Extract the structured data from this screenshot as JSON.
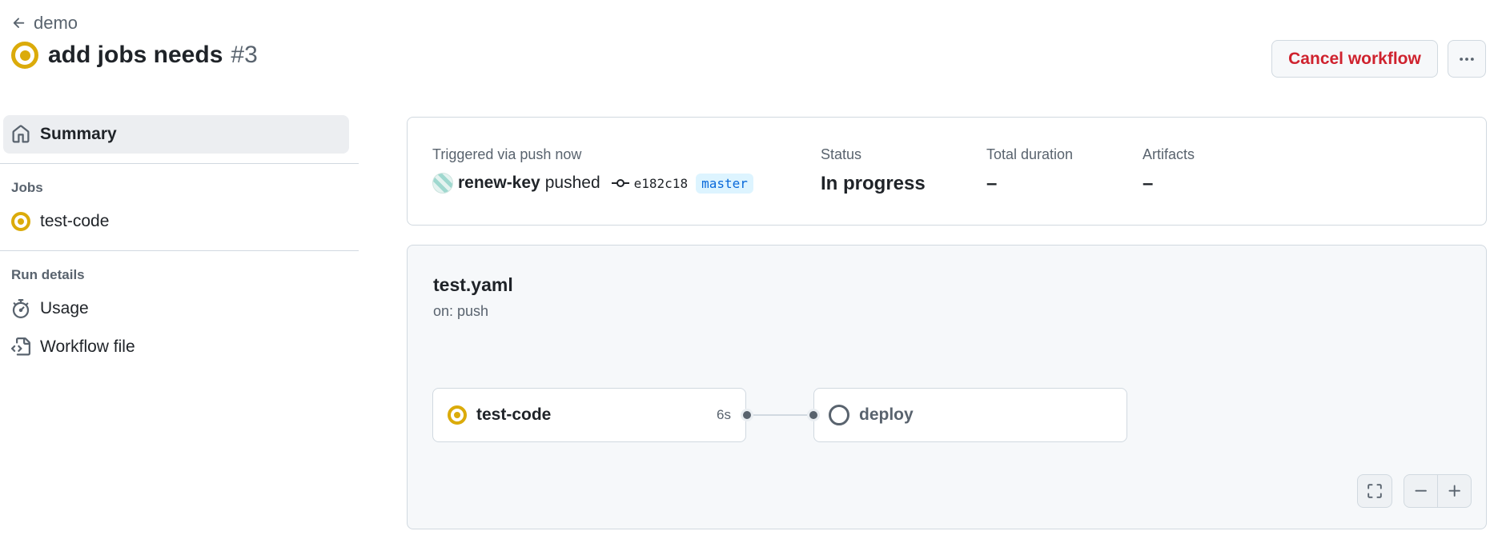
{
  "header": {
    "back_label": "demo",
    "run_title": "add jobs needs",
    "run_number": "#3",
    "cancel_label": "Cancel workflow",
    "more_label": "···"
  },
  "sidebar": {
    "summary_label": "Summary",
    "jobs_heading": "Jobs",
    "jobs": [
      {
        "label": "test-code",
        "status": "in_progress"
      }
    ],
    "run_details_heading": "Run details",
    "usage_label": "Usage",
    "workflow_file_label": "Workflow file"
  },
  "summary": {
    "trigger_label": "Triggered via push now",
    "actor": "renew-key",
    "action": "pushed",
    "commit_sha": "e182c18",
    "branch": "master",
    "status_label": "Status",
    "status_value": "In progress",
    "duration_label": "Total duration",
    "duration_value": "–",
    "artifacts_label": "Artifacts",
    "artifacts_value": "–"
  },
  "graph": {
    "workflow_name": "test.yaml",
    "trigger": "on: push",
    "jobs": [
      {
        "name": "test-code",
        "duration": "6s",
        "status": "in_progress"
      },
      {
        "name": "deploy",
        "duration": "",
        "status": "pending"
      }
    ]
  },
  "colors": {
    "in_progress": "#dbab0a",
    "danger": "#cf222e",
    "link": "#0969da",
    "muted": "#59636e"
  }
}
